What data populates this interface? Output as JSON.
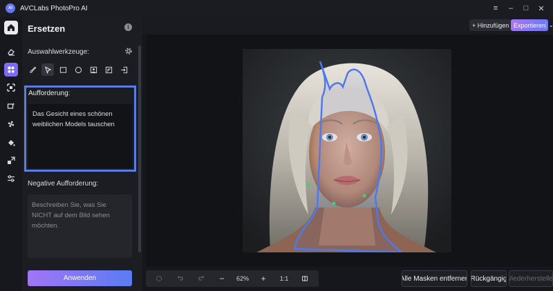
{
  "app": {
    "title": "AVCLabs PhotoPro AI",
    "logo_text": "AI"
  },
  "window_controls": [
    "≡",
    "–",
    "□",
    "✕"
  ],
  "colors": {
    "accent": "#5b7ee5",
    "gradient_start": "#a175f5",
    "gradient_end": "#5a7cf3",
    "mask_outline": "#4d79f0",
    "mask_point": "#3fcf77"
  },
  "sidebar": {
    "items": [
      {
        "icon": "home-icon",
        "active": true
      },
      {
        "icon": "eraser-icon"
      },
      {
        "icon": "replace-icon",
        "active": true
      },
      {
        "icon": "expand-icon"
      },
      {
        "icon": "enhance-icon"
      },
      {
        "icon": "fan-icon"
      },
      {
        "icon": "fill-icon"
      },
      {
        "icon": "resize-icon"
      },
      {
        "icon": "adjust-icon"
      }
    ]
  },
  "panel": {
    "title": "Ersetzen",
    "tools_label": "Auswahlwerkzeuge:",
    "tools": [
      {
        "icon": "brush-icon"
      },
      {
        "icon": "pointer-icon",
        "active": true
      },
      {
        "icon": "rectangle-select-icon"
      },
      {
        "icon": "ellipse-select-icon"
      },
      {
        "icon": "portrait-select-icon"
      },
      {
        "icon": "auto-select-icon"
      },
      {
        "icon": "import-icon"
      }
    ],
    "prompt_label": "Aufforderung:",
    "prompt_value": "Das Gesicht eines schönen weiblichen Models tauschen",
    "negative_label": "Negative Aufforderung:",
    "negative_placeholder": "Beschreiben Sie, was Sie NICHT auf dem Bild sehen möchten.",
    "apply_label": "Anwenden"
  },
  "topbar": {
    "add_label": "+ Hinzufügen",
    "export_label": "Exportieren",
    "export_caret": "⌄"
  },
  "toolbar": {
    "zoom": "62%",
    "ratio": "1:1",
    "minus": "−",
    "plus": "+"
  },
  "actions": {
    "remove_masks": "Alle Masken entfernen",
    "undo": "Rückgängig",
    "redo": "Wiederherstellen"
  }
}
